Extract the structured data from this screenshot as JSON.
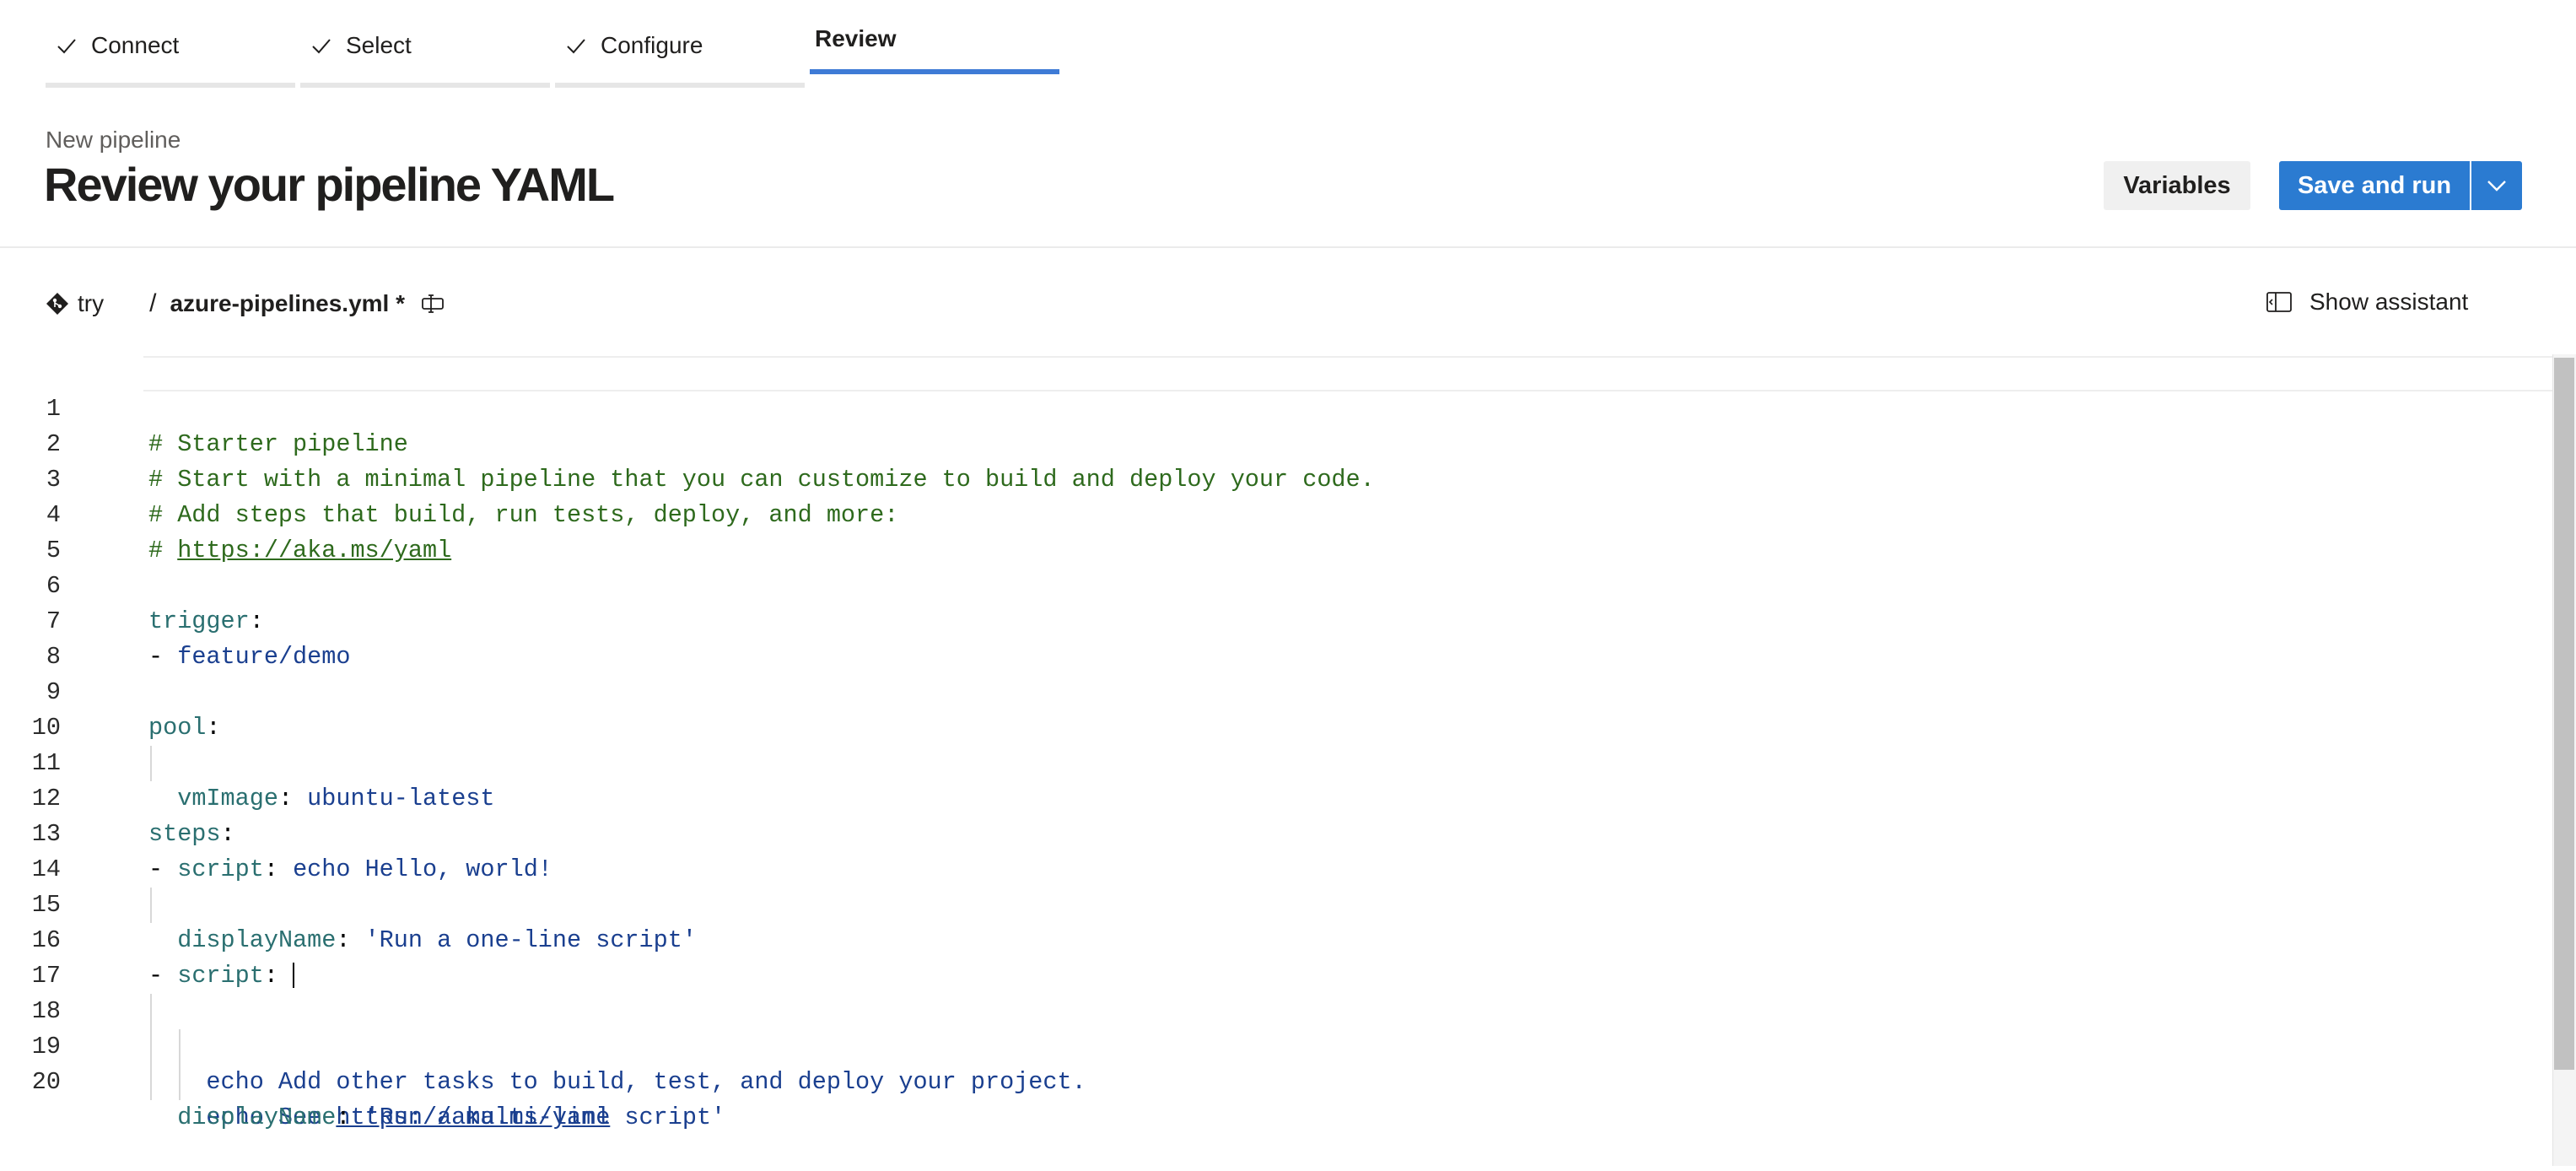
{
  "stepper": {
    "steps": [
      {
        "label": "Connect",
        "state": "done"
      },
      {
        "label": "Select",
        "state": "done"
      },
      {
        "label": "Configure",
        "state": "done"
      },
      {
        "label": "Review",
        "state": "active"
      }
    ]
  },
  "header": {
    "subtitle": "New pipeline",
    "title": "Review your pipeline YAML",
    "variables_label": "Variables",
    "save_label": "Save and run"
  },
  "filebar": {
    "branch": "try",
    "separator": "/",
    "file_name": "azure-pipelines.yml *",
    "assistant_label": "Show assistant"
  },
  "editor": {
    "line_numbers": [
      "1",
      "2",
      "3",
      "4",
      "5",
      "6",
      "7",
      "8",
      "9",
      "10",
      "11",
      "12",
      "13",
      "14",
      "15",
      "16",
      "17",
      "18",
      "19",
      "20"
    ],
    "lines": {
      "l1": "# Starter pipeline",
      "l2": "# Start with a minimal pipeline that you can customize to build and deploy your code.",
      "l3": "# Add steps that build, run tests, deploy, and more:",
      "l4_prefix": "# ",
      "l4_link": "https://aka.ms/yaml",
      "l6_key": "trigger",
      "l7_val": "feature/demo",
      "l9_key": "pool",
      "l10_key": "vmImage",
      "l10_val": "ubuntu-latest",
      "l12_key": "steps",
      "l13_key": "script",
      "l13_val": "echo Hello, world!",
      "l14_key": "displayName",
      "l14_val": "'Run a one-line script'",
      "l16_key": "script",
      "l17_val": "echo Add other tasks to build, test, and deploy your project.",
      "l18_prefix": "echo See ",
      "l18_link": "https://aka.ms/yaml",
      "l19_key": "displayName",
      "l19_val": "'Run a multi-line script'"
    }
  },
  "colors": {
    "accent": "#2b7bd1",
    "stepper_active": "#3e7bd6",
    "comment": "#2e6a1d",
    "yaml_key": "#2a6f70",
    "yaml_value": "#1a3f8f"
  },
  "icons": {
    "step_done": "checkmark-icon",
    "branch": "git-branch-icon",
    "rename": "rename-icon",
    "assistant": "assistant-panel-icon",
    "dropdown": "chevron-down-icon"
  }
}
